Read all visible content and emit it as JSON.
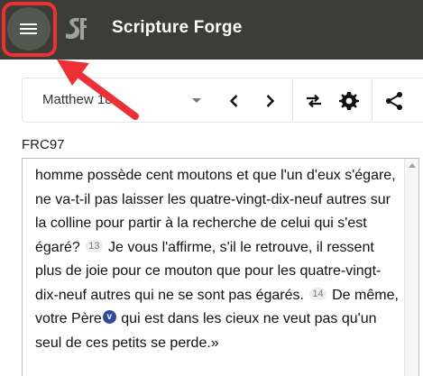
{
  "appbar": {
    "title": "Scripture Forge",
    "menu_icon": "hamburger-menu-icon",
    "logo_icon": "sf-logo-icon",
    "background": "#3b3d36"
  },
  "toolbar": {
    "book_chapter": "Matthew 18",
    "prev_icon": "chevron-left-icon",
    "next_icon": "chevron-right-icon",
    "swap_icon": "swap-arrows-icon",
    "settings_icon": "gear-icon",
    "share_icon": "share-icon"
  },
  "editor": {
    "label": "FRC97",
    "text_1": "homme possède cent moutons et que l'un d'eux s'égare, ne va-t-il pas laisser les quatre-vingt-dix-neuf autres sur la colline pour partir à la recherche de celui qui s'est égaré?",
    "verse_13": "13",
    "text_2": "Je vous l'affirme, s'il le retrouve, il ressent plus de joie pour ce mouton que pour les quatre-vingt-dix-neuf autres qui ne se sont pas égarés.",
    "verse_14": "14",
    "text_3": "De même, votre Père",
    "note_marker": "v",
    "text_4": "qui est dans les cieux ne veut pas qu'un seul de ces petits se perde.»"
  },
  "annotation": {
    "highlight_color": "#ee2f33"
  }
}
